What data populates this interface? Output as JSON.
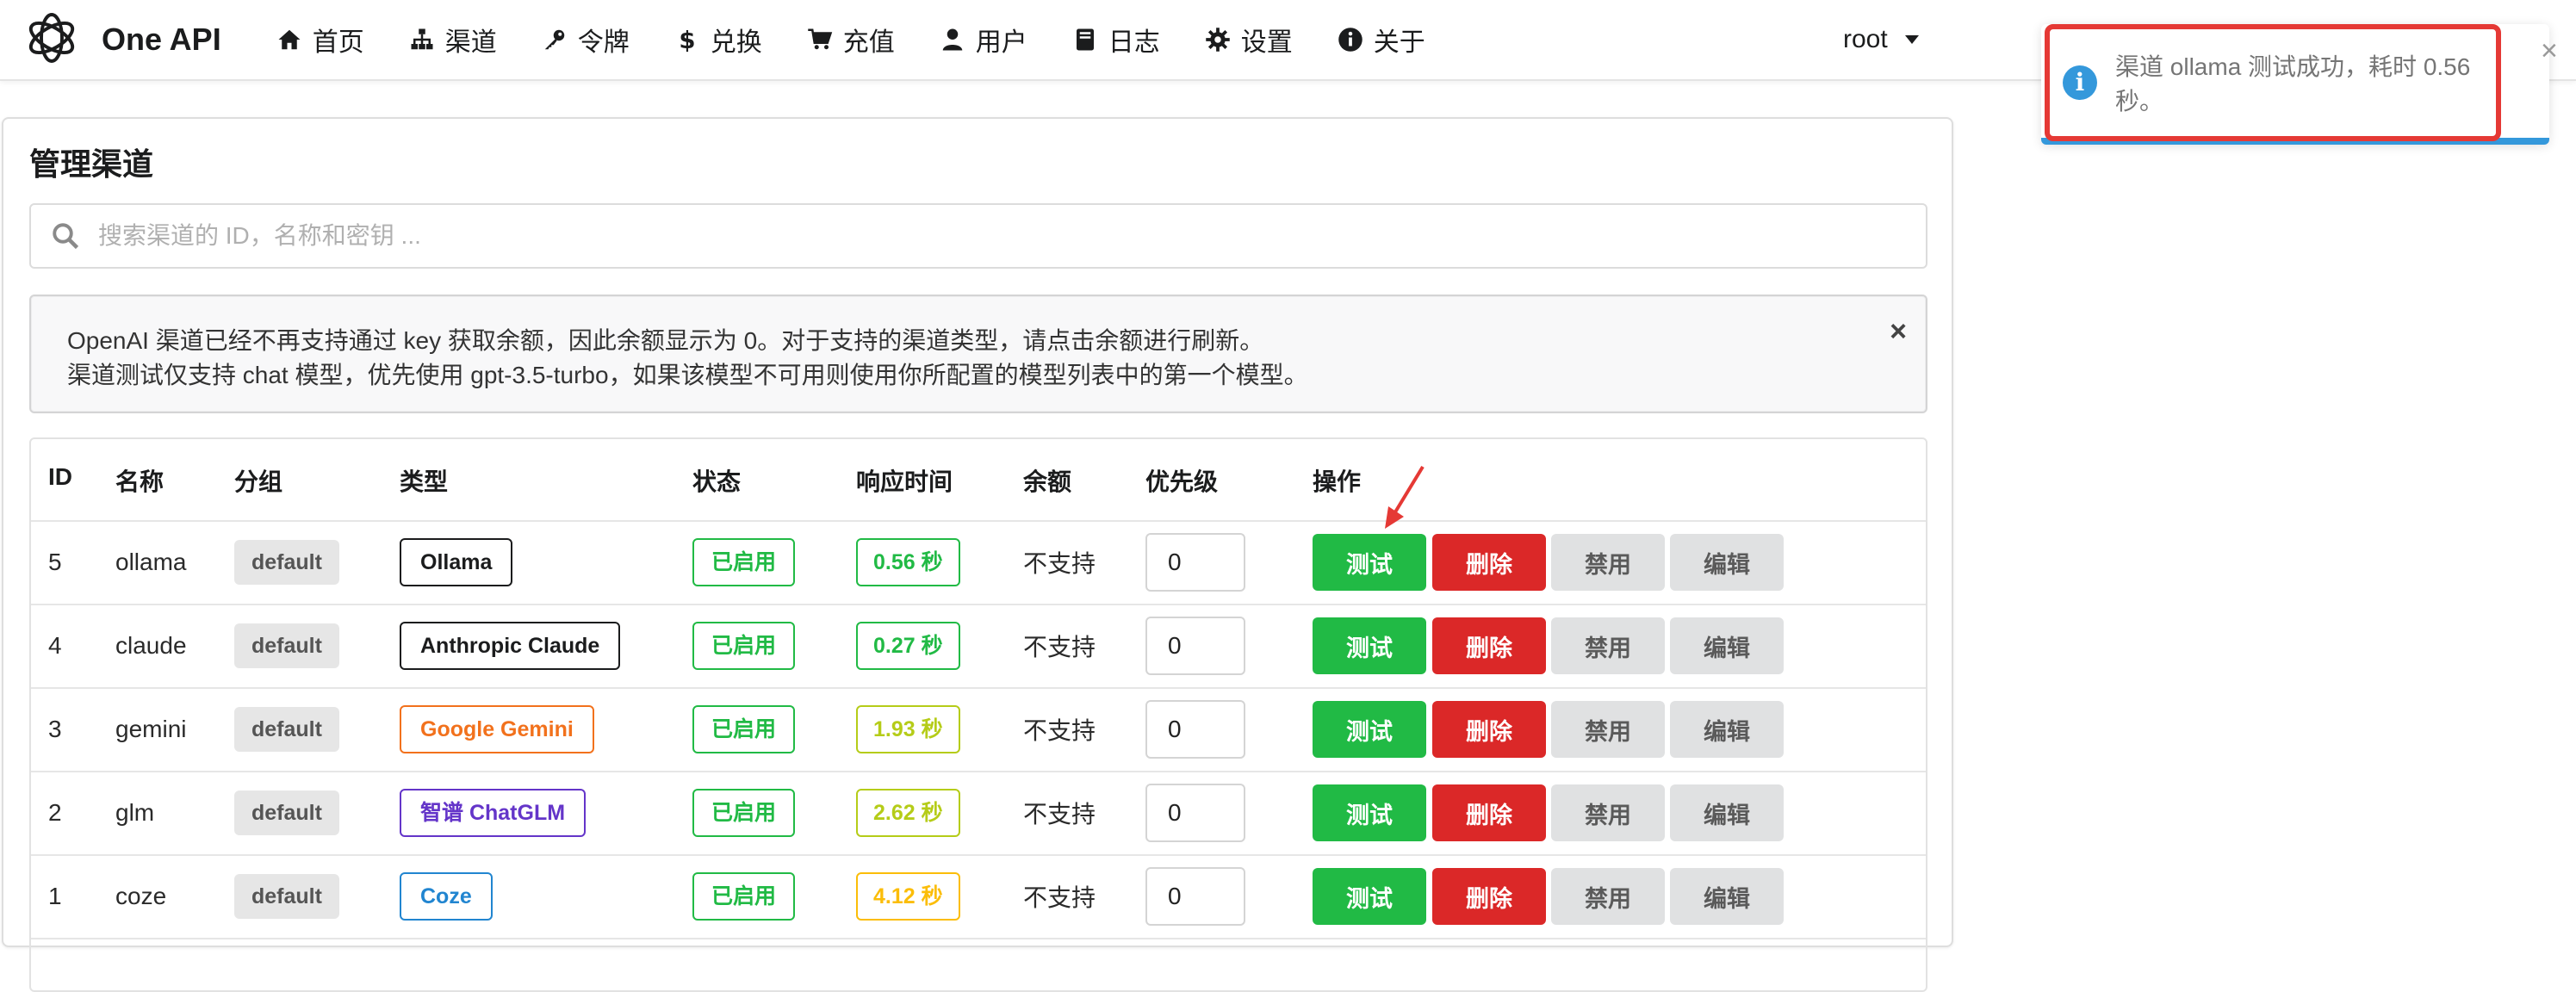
{
  "app": {
    "brand": "One API",
    "user": "root"
  },
  "nav": [
    {
      "label": "首页",
      "icon": "home-icon"
    },
    {
      "label": "渠道",
      "icon": "sitemap-icon"
    },
    {
      "label": "令牌",
      "icon": "key-icon"
    },
    {
      "label": "兑换",
      "icon": "dollar-icon"
    },
    {
      "label": "充值",
      "icon": "cart-icon"
    },
    {
      "label": "用户",
      "icon": "user-icon"
    },
    {
      "label": "日志",
      "icon": "book-icon"
    },
    {
      "label": "设置",
      "icon": "gear-icon"
    },
    {
      "label": "关于",
      "icon": "info-icon"
    }
  ],
  "page": {
    "title": "管理渠道",
    "search_placeholder": "搜索渠道的 ID，名称和密钥 ...",
    "notice": {
      "line1": "OpenAI 渠道已经不再支持通过 key 获取余额，因此余额显示为 0。对于支持的渠道类型，请点击余额进行刷新。",
      "line2": "渠道测试仅支持 chat 模型，优先使用 gpt-3.5-turbo，如果该模型不可用则使用你所配置的模型列表中的第一个模型。",
      "close": "×"
    }
  },
  "table": {
    "headers": [
      "ID",
      "名称",
      "分组",
      "类型",
      "状态",
      "响应时间",
      "余额",
      "优先级",
      "操作"
    ],
    "rows": [
      {
        "id": "5",
        "name": "ollama",
        "group": "default",
        "type": "Ollama",
        "type_color": "#1b1c1d",
        "status": "已启用",
        "rt": "0.56 秒",
        "rt_color": "#21ba45",
        "balance": "不支持",
        "priority": "0"
      },
      {
        "id": "4",
        "name": "claude",
        "group": "default",
        "type": "Anthropic Claude",
        "type_color": "#1b1c1d",
        "status": "已启用",
        "rt": "0.27 秒",
        "rt_color": "#21ba45",
        "balance": "不支持",
        "priority": "0"
      },
      {
        "id": "3",
        "name": "gemini",
        "group": "default",
        "type": "Google Gemini",
        "type_color": "#f2711c",
        "status": "已启用",
        "rt": "1.93 秒",
        "rt_color": "#b5cc18",
        "balance": "不支持",
        "priority": "0"
      },
      {
        "id": "2",
        "name": "glm",
        "group": "default",
        "type": "智谱 ChatGLM",
        "type_color": "#6435c9",
        "status": "已启用",
        "rt": "2.62 秒",
        "rt_color": "#b5cc18",
        "balance": "不支持",
        "priority": "0"
      },
      {
        "id": "1",
        "name": "coze",
        "group": "default",
        "type": "Coze",
        "type_color": "#2185d0",
        "status": "已启用",
        "rt": "4.12 秒",
        "rt_color": "#fbbd08",
        "balance": "不支持",
        "priority": "0"
      }
    ],
    "actions": {
      "test": "测试",
      "delete": "删除",
      "disable": "禁用",
      "edit": "编辑"
    }
  },
  "toast": {
    "icon": "i",
    "message": "渠道 ollama 测试成功，耗时 0.56 秒。",
    "close": "×"
  },
  "colors": {
    "green": "#21ba45",
    "red": "#db2828",
    "grey": "#e0e1e2",
    "info": "#3498db",
    "highlight": "#e53935"
  }
}
